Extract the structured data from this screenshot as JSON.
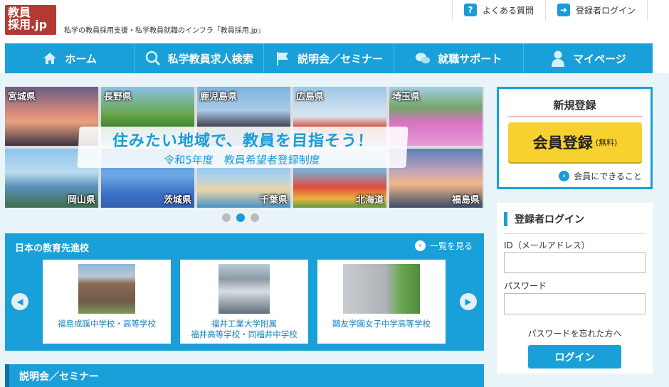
{
  "header": {
    "logo_line1": "教員",
    "logo_line2": "採用.jp",
    "tagline": "私学の教員採用支援・私学教員就職のインフラ「教員採用.jp」",
    "faq_label": "よくある質問",
    "login_link_label": "登録者ログイン"
  },
  "nav": {
    "items": [
      {
        "label": "ホーム",
        "icon": "home-icon"
      },
      {
        "label": "私学教員求人検索",
        "icon": "search-icon"
      },
      {
        "label": "説明会／セミナー",
        "icon": "flag-icon"
      },
      {
        "label": "就職サポート",
        "icon": "chat-bubbles-icon"
      },
      {
        "label": "マイページ",
        "icon": "person-icon"
      }
    ]
  },
  "carousel": {
    "tiles": [
      "宮城県",
      "長野県",
      "鹿児島県",
      "広島県",
      "埼玉県",
      "岡山県",
      "茨城県",
      "千葉県",
      "北海道",
      "福島県"
    ],
    "banner_title": "住みたい地域で、教員を目指そう！",
    "banner_sub": "令和5年度　教員希望者登録制度",
    "active_slide": 2,
    "slide_count": 3
  },
  "schools": {
    "title": "日本の教育先進校",
    "see_all": "一覧を見る",
    "cards": [
      {
        "name_line1": "福島成蹊中学校・高等学校",
        "name_line2": ""
      },
      {
        "name_line1": "福井工業大学附属",
        "name_line2": "福井高等学校・同福井中学校"
      },
      {
        "name_line1": "鷗友学園女子中学高等学校",
        "name_line2": ""
      }
    ]
  },
  "seminar": {
    "title": "説明会／セミナー"
  },
  "register": {
    "title": "新規登録",
    "button_main": "会員登録",
    "button_note": "(無料)",
    "link": "会員にできること"
  },
  "login": {
    "title": "登録者ログイン",
    "id_label": "ID（メールアドレス）",
    "password_label": "パスワード",
    "forgot": "パスワードを忘れた方へ",
    "button": "ログイン"
  },
  "colors": {
    "accent": "#1aa0d8",
    "logo": "#b23a32",
    "cta": "#f7d12f"
  }
}
